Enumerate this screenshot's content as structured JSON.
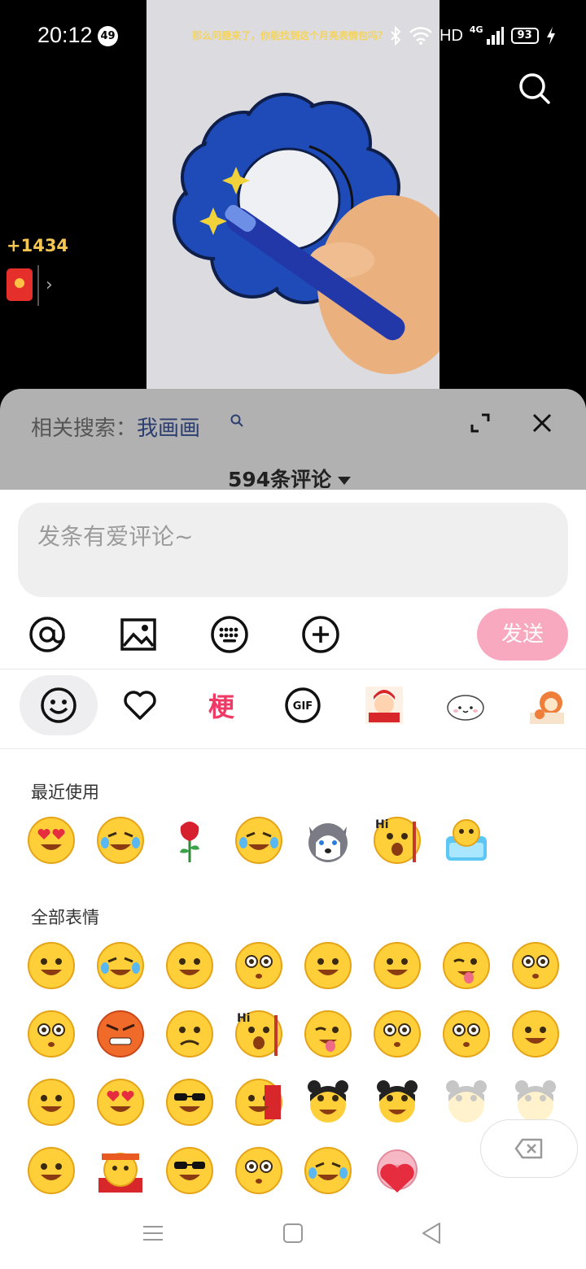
{
  "status_bar": {
    "time": "20:12",
    "notification_badge": "49",
    "ticker_text": "那么问题来了，你能找到这个月亮表情包吗？",
    "hd_label": "HD",
    "network_label": "4G",
    "battery": "93"
  },
  "video": {
    "coin_count": "+1434",
    "redpack_chevron": "›"
  },
  "panel": {
    "related_prefix": "相关搜索：",
    "related_keyword": "我画画",
    "comment_count": "594条评论"
  },
  "composer": {
    "placeholder": "发条有爱评论~",
    "send_label": "发送"
  },
  "emoji_tabs": {
    "geng_label": "梗"
  },
  "emoji_panel": {
    "recent_title": "最近使用",
    "all_title": "全部表情"
  },
  "icons": [
    "search-icon",
    "expand-icon",
    "close-icon",
    "mention-icon",
    "image-icon",
    "keyboard-icon",
    "plus-icon",
    "smiley-icon",
    "heart-icon",
    "gif-icon",
    "backspace-icon",
    "menu-icon",
    "home-icon",
    "back-icon"
  ],
  "colors": {
    "send_button": "#f9a9bf",
    "geng_tab": "#f03a66",
    "coin_text": "#f6c653",
    "panel_header_bg": "#b1b1b1"
  }
}
